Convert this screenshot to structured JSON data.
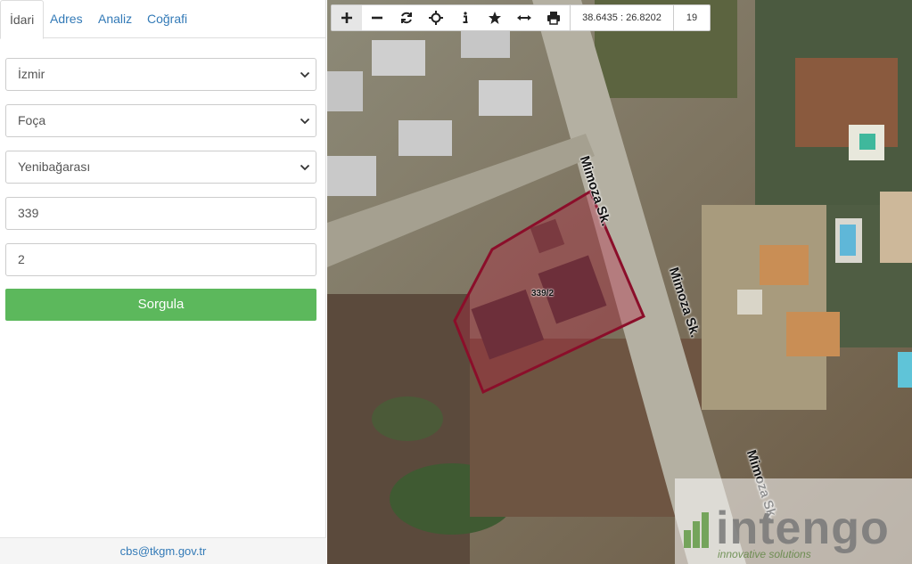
{
  "tabs": [
    {
      "label": "İdari",
      "active": true
    },
    {
      "label": "Adres",
      "active": false
    },
    {
      "label": "Analiz",
      "active": false
    },
    {
      "label": "Coğrafi",
      "active": false
    }
  ],
  "form": {
    "il": "İzmir",
    "ilce": "Foça",
    "mahalle": "Yenibağarası",
    "ada": "339",
    "parsel": "2",
    "submit_label": "Sorgula"
  },
  "footer": {
    "email": "cbs@tkgm.gov.tr"
  },
  "map": {
    "coordinates": "38.6435 : 26.8202",
    "zoom_level": "19",
    "parcel_label": "339/2",
    "street_names": [
      "Mimoza Sk.",
      "Mimoza Sk.",
      "Mimoza Sk."
    ],
    "watermark": {
      "brand": "intengo",
      "tagline": "innovative solutions"
    },
    "toolbar_icons": [
      "plus-icon",
      "minus-icon",
      "refresh-icon",
      "crosshair-icon",
      "info-icon",
      "star-icon",
      "measure-icon",
      "print-icon"
    ]
  },
  "colors": {
    "link": "#337ab7",
    "submit": "#5cb85c",
    "parcel_stroke": "#8b0e2a",
    "parcel_fill": "rgba(180,30,60,0.35)"
  }
}
